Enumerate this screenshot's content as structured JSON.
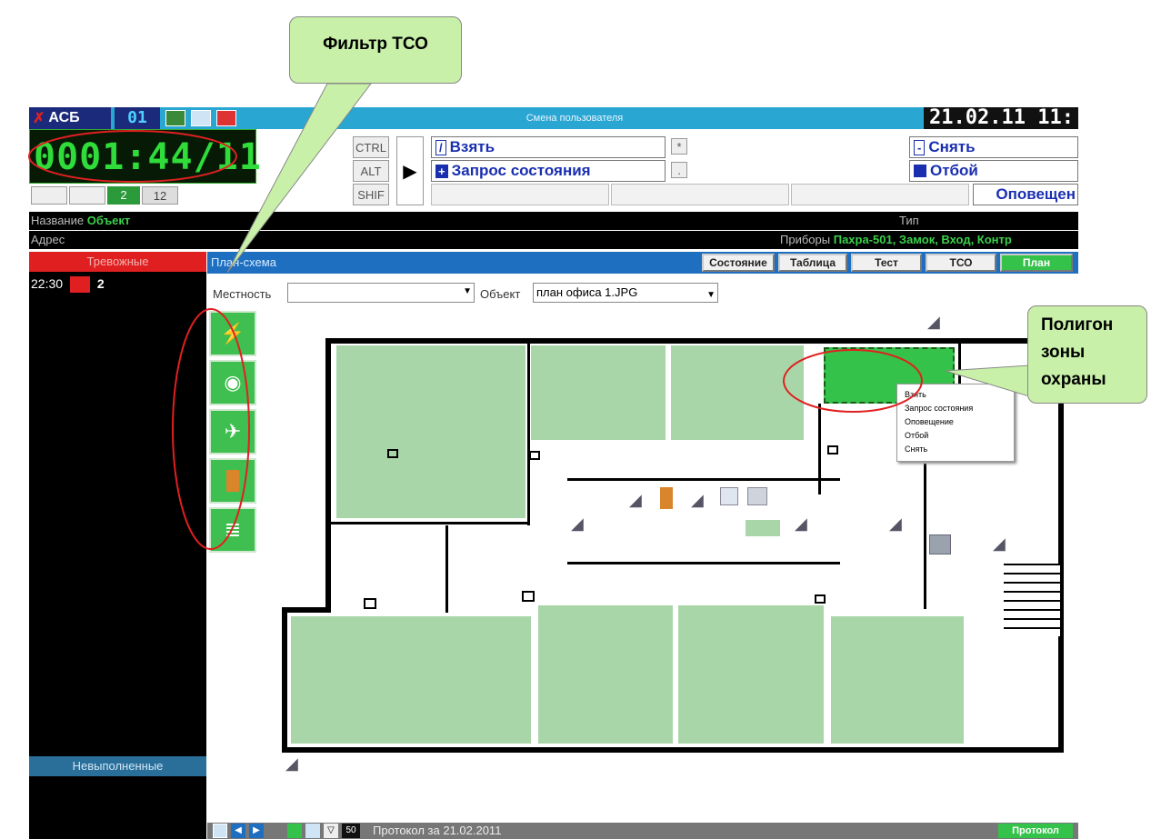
{
  "callouts": {
    "filter": "Фильтр ТСО",
    "polygon_lines": [
      "Полигон",
      "зоны",
      "охраны"
    ]
  },
  "topbar": {
    "logo": "АСБ",
    "counter": "01",
    "title": "Смена пользователя",
    "date": "21.02.11 11:"
  },
  "clock": {
    "digits": "0001:44/11"
  },
  "counts": {
    "a": "",
    "b": "",
    "c": "2",
    "d": "12"
  },
  "keys": {
    "ctrl": "CTRL",
    "alt": "ALT",
    "shift": "SHIF"
  },
  "actions": {
    "take": "Взять",
    "query": "Запрос состояния",
    "take_key": "/",
    "query_key": "+",
    "star_key": "*",
    "dot_key": ".",
    "unset": "Снять",
    "unset_key": "-",
    "cancel": "Отбой",
    "notify": "Оповещен"
  },
  "info": {
    "name_label": "Название",
    "name_value": "Объект",
    "type_label": "Тип",
    "addr_label": "Адрес",
    "devices_label": "Приборы",
    "devices_value": "Пахра-501, Замок, Вход, Контр"
  },
  "alarms": {
    "header": "Тревожные",
    "time": "22:30",
    "count": "2",
    "unfinished": "Невыполненные"
  },
  "plan": {
    "header": "План-схема",
    "tabs": [
      "Состояние",
      "Таблица",
      "Тест",
      "ТСО",
      "План"
    ],
    "area_label": "Местность",
    "area_value": "",
    "object_label": "Объект",
    "object_value": "план офиса 1.JPG"
  },
  "context_menu": [
    "Взять",
    "Запрос состояния",
    "Оповещение",
    "Отбой",
    "Снять"
  ],
  "bottom": {
    "count": "50",
    "protocol_text": "Протокол за 21.02.2011",
    "protocol_button": "Протокол"
  },
  "colors": {
    "green": "#35c24a",
    "room": "#a9d6a9",
    "blue": "#1e6fc0",
    "red": "#e02020"
  }
}
